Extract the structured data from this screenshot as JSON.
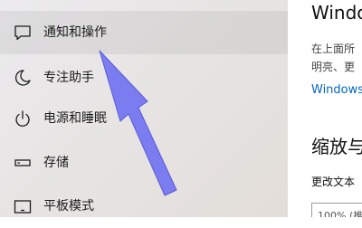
{
  "sidebar": {
    "items": [
      {
        "label": "通知和操作",
        "icon": "notification-icon",
        "selected": true
      },
      {
        "label": "专注助手",
        "icon": "moon-icon",
        "selected": false
      },
      {
        "label": "电源和睡眠",
        "icon": "power-icon",
        "selected": false
      },
      {
        "label": "存储",
        "icon": "storage-icon",
        "selected": false
      },
      {
        "label": "平板模式",
        "icon": "tablet-icon",
        "selected": false
      }
    ]
  },
  "content": {
    "heading": "Windo",
    "description_line1": "在上面所",
    "description_line2": "明亮、更",
    "link": "Windows",
    "section_heading": "缩放与",
    "change_text_label": "更改文本",
    "scale_value": "100% (推"
  },
  "annotation": {
    "arrow_color": "#7b7cf0"
  }
}
